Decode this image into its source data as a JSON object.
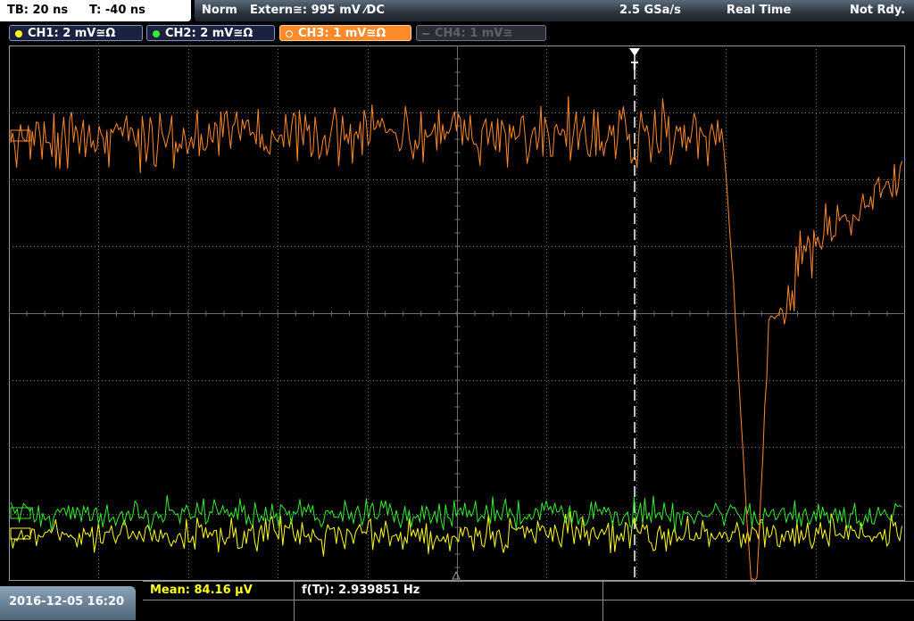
{
  "topbar": {
    "timebase": "TB: 20 ns",
    "trigger_time": "T: -40 ns",
    "mode": "Norm",
    "trigger_source": "Extern≅: 995 mV ⁄DC",
    "sample_rate": "2.5 GSa/s",
    "acq_mode": "Real Time",
    "status": "Not Rdy."
  },
  "channels": [
    {
      "label": "CH1: 2 mV≅Ω",
      "color": "#ffff1e",
      "state": "on"
    },
    {
      "label": "CH2: 2 mV≅Ω",
      "color": "#33ee33",
      "state": "on"
    },
    {
      "label": "CH3: 1 mV≅Ω",
      "color": "#ff8a2a",
      "state": "selected"
    },
    {
      "label": "CH4: 1 mV≅",
      "color": "#5c6068",
      "state": "off"
    }
  ],
  "screen": {
    "trigger_marker": "T",
    "grid_color": "#6e6e6e",
    "trace_colors": {
      "ch1": "#ffff1e",
      "ch2": "#33ee33",
      "ch3": "#ff8a2a"
    }
  },
  "bottom": {
    "datetime": "2016-12-05 16:20",
    "measurements": [
      {
        "text": "Mean: 84.16 µV",
        "color": "#ffff1e"
      },
      {
        "text": "f(Tr): 2.939851 Hz",
        "color": "#ffffff"
      }
    ]
  }
}
